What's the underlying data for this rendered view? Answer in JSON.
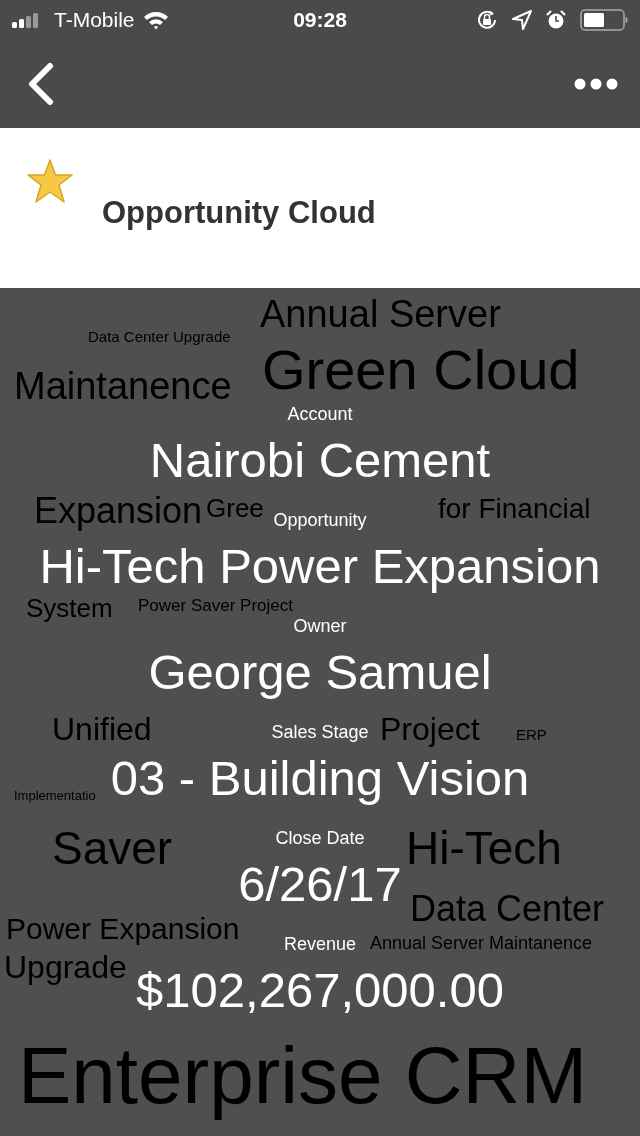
{
  "status_bar": {
    "carrier": "T-Mobile",
    "time": "09:28"
  },
  "header": {
    "title": "Opportunity Cloud",
    "favorite": true
  },
  "word_cloud": [
    {
      "text": "Data Center Upgrade"
    },
    {
      "text": "Annual Server"
    },
    {
      "text": "Maintanence"
    },
    {
      "text": "Green Cloud"
    },
    {
      "text": "Expansion"
    },
    {
      "text": "Gree"
    },
    {
      "text": "for Financial"
    },
    {
      "text": "System"
    },
    {
      "text": "Power Saver Project"
    },
    {
      "text": "Unified"
    },
    {
      "text": "Project"
    },
    {
      "text": "ERP"
    },
    {
      "text": "Implementatio"
    },
    {
      "text": "Saver"
    },
    {
      "text": "Hi-Tech"
    },
    {
      "text": "Power Expansion"
    },
    {
      "text": "Data Center"
    },
    {
      "text": "Upgrade"
    },
    {
      "text": "Annual Server Maintanence"
    },
    {
      "text": "Enterprise CRM"
    }
  ],
  "details": [
    {
      "label": "Account",
      "value": "Nairobi Cement"
    },
    {
      "label": "Opportunity",
      "value": "Hi-Tech Power Expansion"
    },
    {
      "label": "Owner",
      "value": "George Samuel"
    },
    {
      "label": "Sales Stage",
      "value": "03 - Building Vision"
    },
    {
      "label": "Close Date",
      "value": "6/26/17"
    },
    {
      "label": "Revenue",
      "value": "$102,267,000.00"
    }
  ]
}
